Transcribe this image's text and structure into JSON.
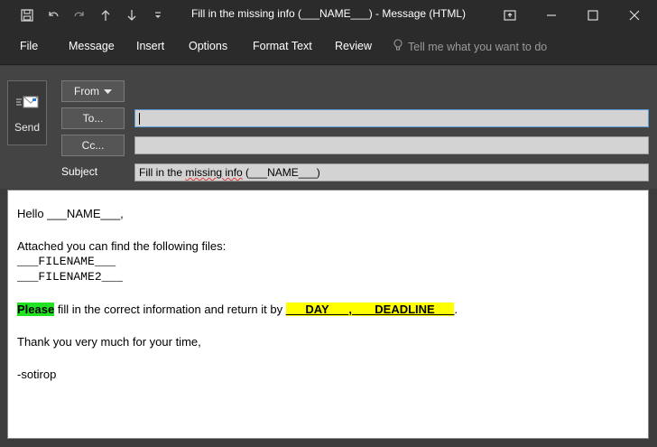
{
  "window": {
    "title": "Fill in the missing info (___NAME___) - Message (HTML)",
    "quick_access": [
      "save-icon",
      "undo-icon",
      "redo-icon",
      "up-arrow-icon",
      "down-arrow-icon",
      "customize-icon"
    ],
    "controls": [
      "restore-icon",
      "minimize-icon",
      "maximize-icon",
      "close-icon"
    ]
  },
  "ribbon": {
    "tabs": [
      "File",
      "Message",
      "Insert",
      "Options",
      "Format Text",
      "Review"
    ],
    "tell_me_placeholder": "Tell me what you want to do"
  },
  "header": {
    "send_label": "Send",
    "from_label": "From",
    "to_label": "To...",
    "cc_label": "Cc...",
    "subject_label": "Subject",
    "to_value": "",
    "cc_value": "",
    "subject_value_part1": "Fill in the ",
    "subject_value_misspelled": "missing info",
    "subject_value_part2": " (___NAME___)"
  },
  "body": {
    "greeting": "Hello ___NAME___,",
    "attach_intro": "Attached you can find the following files:",
    "file1": "___FILENAME___",
    "file2": "___FILENAME2___",
    "please_word": "Please",
    "instruction": " fill in the correct information and return it by ",
    "deadline": "___DAY___, ___DEADLINE___",
    "period": ".",
    "thanks": "Thank you very much for your time,",
    "signature": "-sotirop"
  },
  "colors": {
    "title_bar": "#2b2b2b",
    "header_bg": "#444444",
    "green_highlight": "#22e322",
    "yellow_highlight": "#ffff00"
  }
}
